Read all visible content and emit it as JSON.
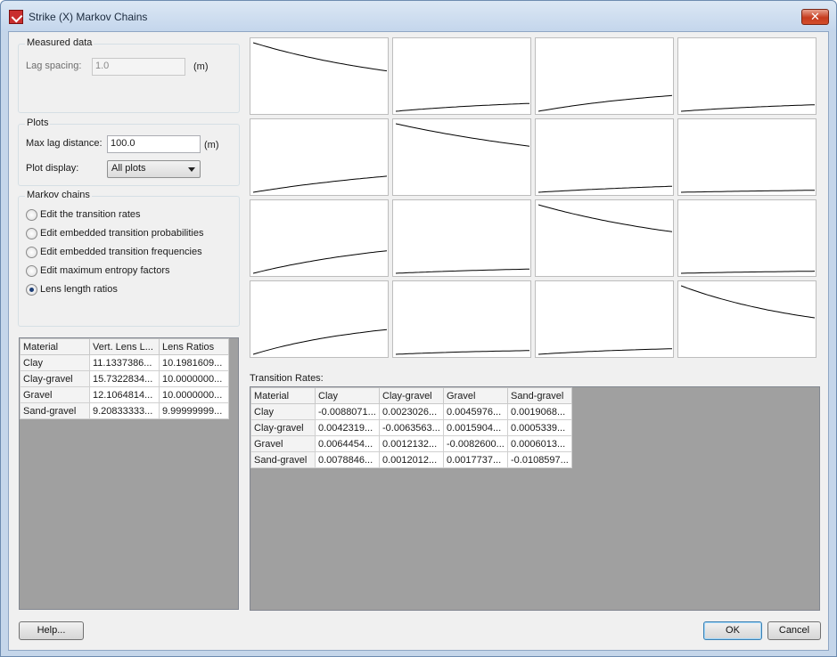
{
  "window": {
    "title": "Strike (X) Markov Chains",
    "close_glyph": "✕"
  },
  "measured": {
    "group_title": "Measured data",
    "lag_label": "Lag spacing:",
    "lag_value": "1.0",
    "lag_unit": "(m)"
  },
  "plots_group": {
    "group_title": "Plots",
    "max_lag_label": "Max lag distance:",
    "max_lag_value": "100.0",
    "max_lag_unit": "(m)",
    "display_label": "Plot display:",
    "display_value": "All plots"
  },
  "markov": {
    "group_title": "Markov chains",
    "options": [
      {
        "label": "Edit the transition rates",
        "checked": false
      },
      {
        "label": "Edit embedded transition probabilities",
        "checked": false
      },
      {
        "label": "Edit embedded transition frequencies",
        "checked": false
      },
      {
        "label": "Edit maximum entropy factors",
        "checked": false
      },
      {
        "label": "Lens length ratios",
        "checked": true
      }
    ]
  },
  "lens_table": {
    "headers": [
      "Material",
      "Vert. Lens L...",
      "Lens Ratios"
    ],
    "rows": [
      [
        "Clay",
        "11.1337386...",
        "10.1981609..."
      ],
      [
        "Clay-gravel",
        "15.7322834...",
        "10.0000000..."
      ],
      [
        "Gravel",
        "12.1064814...",
        "10.0000000..."
      ],
      [
        "Sand-gravel",
        "9.20833333...",
        "9.99999999..."
      ]
    ]
  },
  "rates": {
    "label": "Transition Rates:",
    "headers": [
      "Material",
      "Clay",
      "Clay-gravel",
      "Gravel",
      "Sand-gravel"
    ],
    "rows": [
      [
        "Clay",
        "-0.0088071...",
        "0.0023026...",
        "0.0045976...",
        "0.0019068..."
      ],
      [
        "Clay-gravel",
        "0.0042319...",
        "-0.0063563...",
        "0.0015904...",
        "0.0005339..."
      ],
      [
        "Gravel",
        "0.0064454...",
        "0.0012132...",
        "-0.0082600...",
        "0.0006013..."
      ],
      [
        "Sand-gravel",
        "0.0078846...",
        "0.0012012...",
        "0.0017737...",
        "-0.0108597..."
      ]
    ]
  },
  "buttons": {
    "help": "Help...",
    "ok": "OK",
    "cancel": "Cancel"
  },
  "colors": {
    "grid_bg": "#a0a0a0",
    "curve": "#000000",
    "title_bar": "#c4d6ec"
  }
}
